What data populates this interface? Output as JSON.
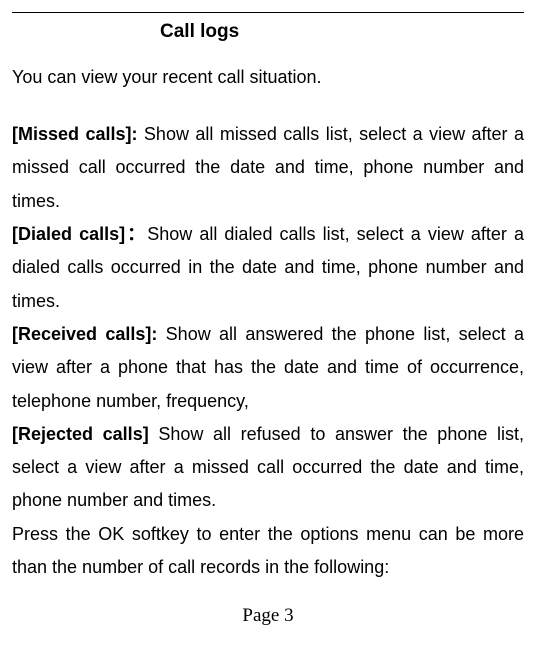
{
  "heading": "Call logs",
  "intro": "You can view your recent call situation.",
  "items": [
    {
      "label": "[Missed calls]: ",
      "text": "Show all missed calls list, select a view after a missed call occurred the date and time, phone number and times."
    },
    {
      "label": "[Dialed calls]：",
      "text": "Show all dialed calls list, select a view after a dialed calls occurred in the date and time, phone number and times."
    },
    {
      "label": "[Received calls]: ",
      "text": "Show all answered the phone list, select a view after a phone that has the date and time of occurrence, telephone number, frequency,"
    },
    {
      "label": "[Rejected calls] ",
      "text": "Show all refused to answer the phone list, select a view after a missed call occurred the date and time, phone number and times."
    }
  ],
  "closing": "Press the OK softkey to enter the options menu can be more than the number of call records in the following:",
  "pageNumber": "Page 3"
}
